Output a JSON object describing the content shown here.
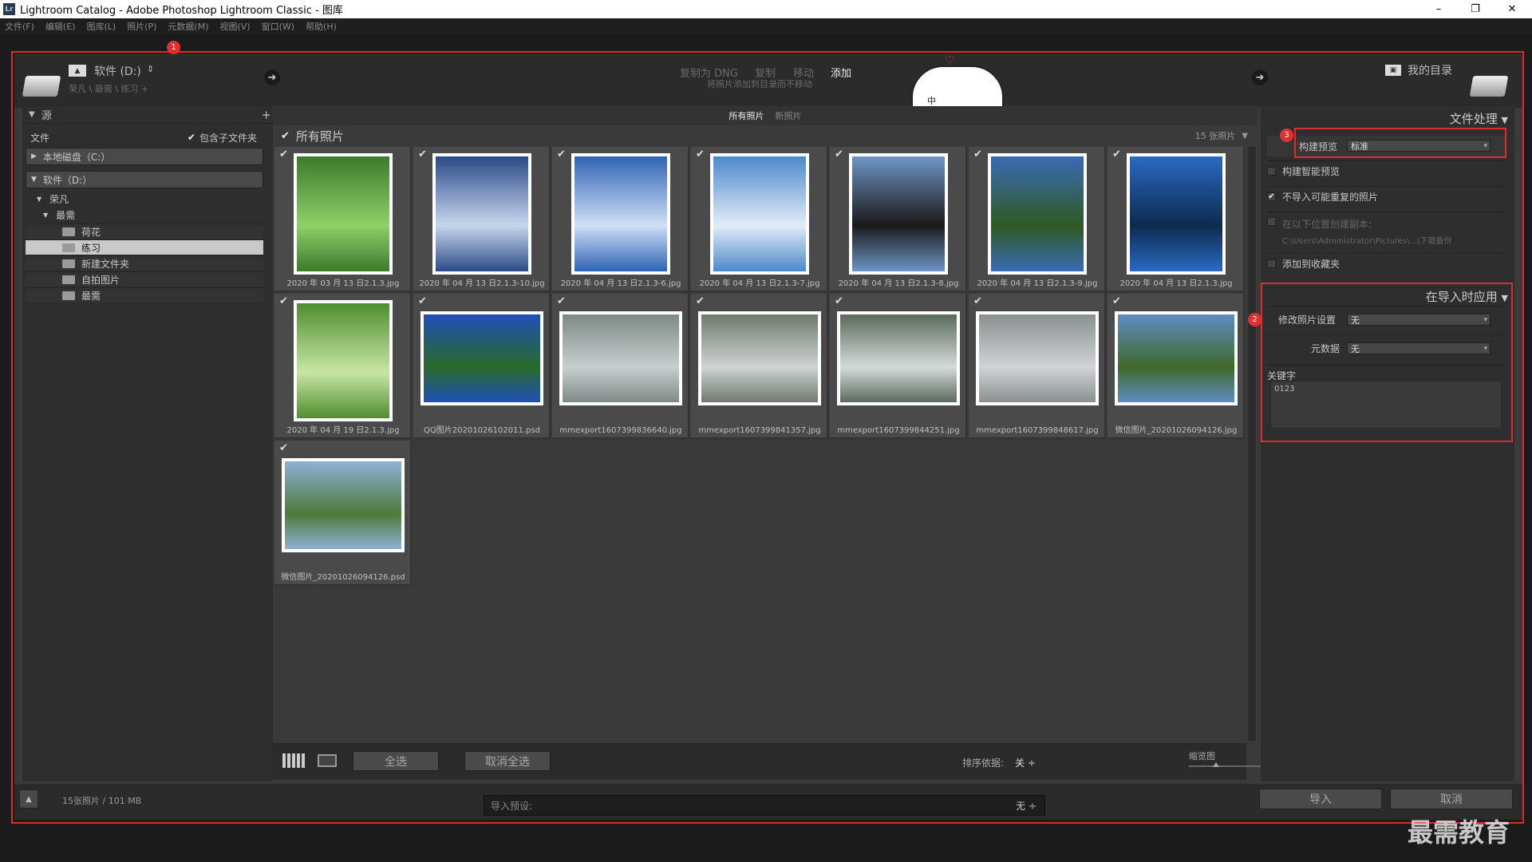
{
  "titlebar": {
    "title": "Lightroom Catalog - Adobe Photoshop Lightroom Classic - 图库",
    "minimize": "–",
    "restore": "❐",
    "close": "✕"
  },
  "menu": [
    "文件(F)",
    "编辑(E)",
    "图库(L)",
    "照片(P)",
    "元数据(M)",
    "视图(V)",
    "窗口(W)",
    "帮助(H)"
  ],
  "header": {
    "source_drive": "软件 (D:)",
    "source_path": "荣凡 \\ 最需 \\ 练习 +",
    "modes": [
      "复制为 DNG",
      "复制",
      "移动",
      "添加"
    ],
    "mode_hint": "将照片添加到目录而不移动",
    "dest": "我的目录"
  },
  "left": {
    "title": "源",
    "files_label": "文件",
    "include_sub": "包含子文件夹",
    "drives": [
      "本地磁盘（C:）",
      "软件（D:）"
    ],
    "tree": [
      "荣凡",
      "最需",
      "荷花",
      "练习",
      "新建文件夹",
      "自拍图片",
      "最需"
    ]
  },
  "center": {
    "tabs": [
      "所有照片",
      "新照片"
    ],
    "grid_title": "所有照片",
    "count": "15 张照片",
    "photos": [
      {
        "name": "2020 年 03 月 13 日2.1.3.jpg",
        "color": "#3d7a2a",
        "tone": "#8fd06a"
      },
      {
        "name": "2020 年 04 月 13 日2.1.3-10.jpg",
        "color": "#2b4a86",
        "tone": "#c7d6ee"
      },
      {
        "name": "2020 年 04 月 13 日2.1.3-6.jpg",
        "color": "#2f63b5",
        "tone": "#cfe0f7"
      },
      {
        "name": "2020 年 04 月 13 日2.1.3-7.jpg",
        "color": "#4c88cc",
        "tone": "#e2ecf7"
      },
      {
        "name": "2020 年 04 月 13 日2.1.3-8.jpg",
        "color": "#6f95c6",
        "tone": "#1a1a1a"
      },
      {
        "name": "2020 年 04 月 13 日2.1.3-9.jpg",
        "color": "#3a6bb5",
        "tone": "#2f5a22"
      },
      {
        "name": "2020 年 04 月 13 日2.1.3.jpg",
        "color": "#2b6ac4",
        "tone": "#0e2a4e"
      },
      {
        "name": "2020 年 04 月 19 日2.1.3.jpg",
        "color": "#4f8d2f",
        "tone": "#c7e6a4"
      },
      {
        "name": "QQ图片20201026102011.psd",
        "color": "#1d50b8",
        "tone": "#2a6a2a"
      },
      {
        "name": "mmexport1607399836640.jpg",
        "color": "#7d8a86",
        "tone": "#c9cfcf"
      },
      {
        "name": "mmexport1607399841357.jpg",
        "color": "#6c7a6c",
        "tone": "#cfd4d2"
      },
      {
        "name": "mmexport1607399844251.jpg",
        "color": "#5a6a5a",
        "tone": "#d5dada"
      },
      {
        "name": "mmexport1607399848617.jpg",
        "color": "#8a8f8f",
        "tone": "#d0d4d6"
      },
      {
        "name": "微信图片_20201026094126.jpg",
        "color": "#5f8cc4",
        "tone": "#3f6a2a"
      },
      {
        "name": "微信图片_20201026094126.psd",
        "color": "#8fb0d6",
        "tone": "#4f7a3a"
      }
    ],
    "select_all": "全选",
    "deselect_all": "取消全选",
    "sort_label": "排序依据:",
    "sort_value": "关 ÷",
    "thumb_label": "缩览图"
  },
  "right": {
    "file_handling": "文件处理",
    "preview_label": "构建预览",
    "preview_value": "标准",
    "smart_preview": "构建智能预览",
    "no_duplicates": "不导入可能重复的照片",
    "second_copy": "在以下位置创建副本:",
    "second_path": "C:\\Users\\Administrator\\Pictures\\...\\下载备份",
    "add_collection": "添加到收藏夹",
    "apply_title": "在导入时应用",
    "develop_label": "修改照片设置",
    "develop_value": "无",
    "meta_label": "元数据",
    "meta_value": "无",
    "keywords_label": "关键字",
    "keywords_value": "0123"
  },
  "bottom": {
    "summary": "15张照片 / 101 MB",
    "preset_label": "导入预设:",
    "preset_value": "无 ÷",
    "import": "导入",
    "cancel": "取消"
  },
  "annotations": [
    "1",
    "2",
    "3"
  ],
  "watermark": "最需教育",
  "sticker_text": "中"
}
